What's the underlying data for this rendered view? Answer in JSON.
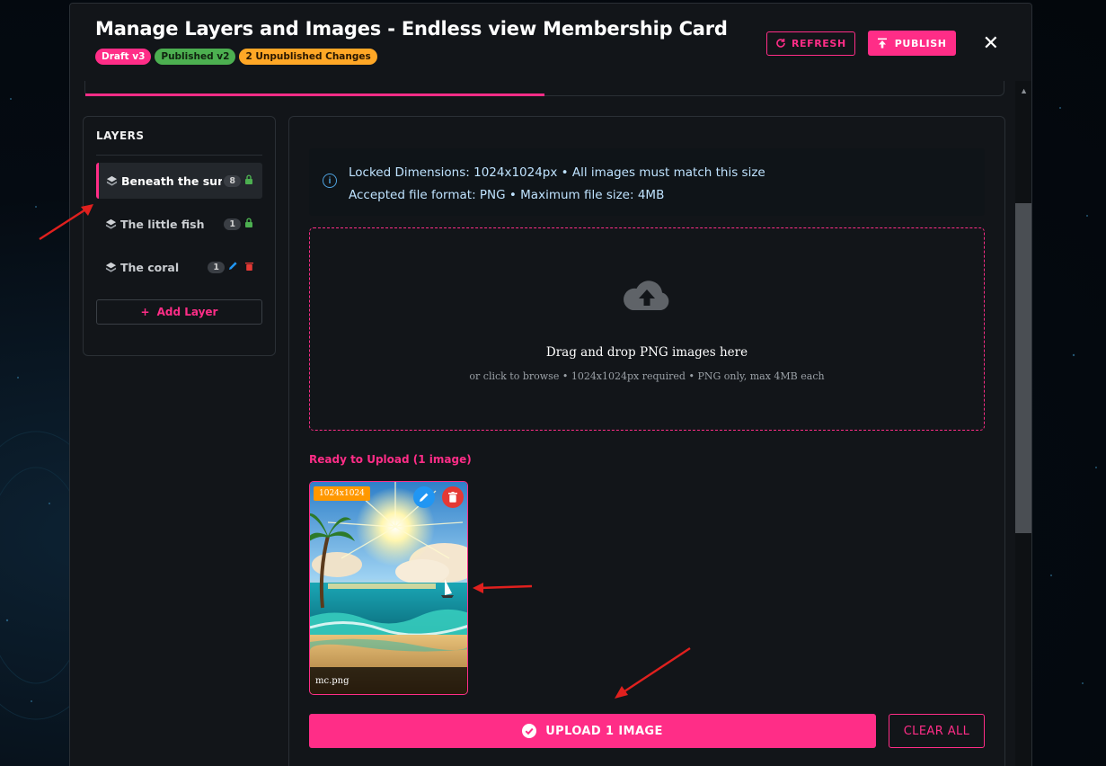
{
  "modal": {
    "title": "Manage Layers and Images - Endless view Membership Card",
    "badges": {
      "draft": "Draft v3",
      "published": "Published v2",
      "unpublished": "2 Unpublished Changes"
    },
    "refresh_label": "REFRESH",
    "publish_label": "PUBLISH",
    "close_label": "✕"
  },
  "layers": {
    "title": "LAYERS",
    "items": [
      {
        "name": "Beneath the sur…",
        "count": "8",
        "status": "locked"
      },
      {
        "name": "The little fish",
        "count": "1",
        "status": "locked"
      },
      {
        "name": "The coral",
        "count": "1",
        "status": "editable"
      }
    ],
    "add_label": "Add Layer"
  },
  "info": {
    "line1": "Locked Dimensions: 1024x1024px • All images must match this size",
    "line2": "Accepted file format: PNG • Maximum file size: 4MB"
  },
  "dropzone": {
    "title": "Drag and drop PNG images here",
    "subtitle": "or click to browse • 1024x1024px required • PNG only, max 4MB each"
  },
  "ready": {
    "label": "Ready to Upload (1 image)",
    "files": [
      {
        "name": "mc.png",
        "dimensions": "1024x1024"
      }
    ]
  },
  "actions": {
    "upload_label": "UPLOAD 1 IMAGE",
    "clear_label": "CLEAR ALL"
  },
  "colors": {
    "accent": "#ff2d87",
    "success": "#4caf50",
    "warning": "#ffa726",
    "info": "#4fa3e0"
  }
}
